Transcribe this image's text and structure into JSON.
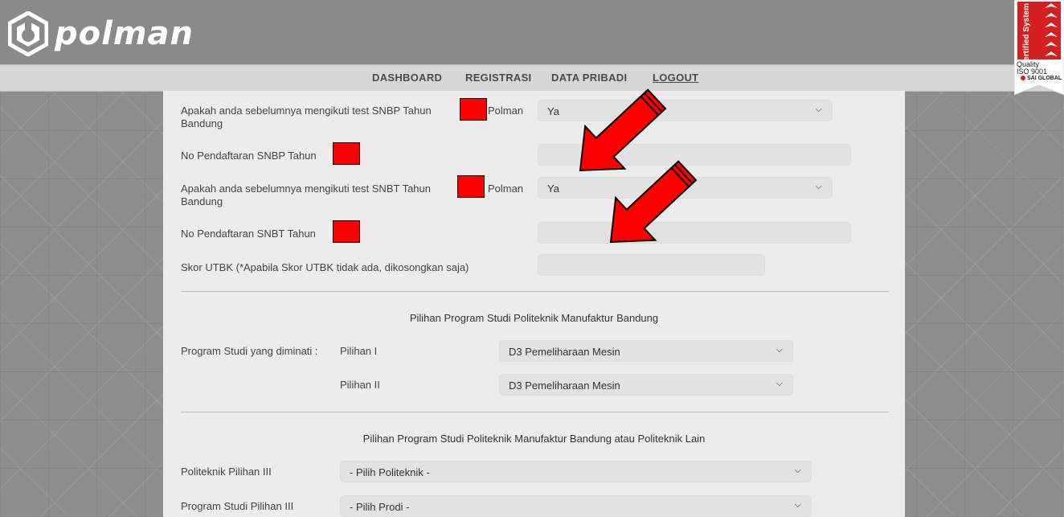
{
  "header": {
    "brand": "polman",
    "cert": {
      "line1": "Certified System",
      "line2": "Quality",
      "line3": "ISO 9001",
      "line4": "SAI GLOBAL"
    }
  },
  "nav": {
    "items": [
      "DASHBOARD",
      "REGISTRASI",
      "DATA PRIBADI",
      "LOGOUT"
    ]
  },
  "form": {
    "snbp_question_1": "Apakah anda sebelumnya mengikuti test SNBP Tahun",
    "snbp_question_2": "Polman",
    "snbp_question_3": "Bandung",
    "snbp_answer": "Ya",
    "snbp_no_label": "No Pendaftaran SNBP Tahun",
    "snbp_no_value": "",
    "snbt_question_1": "Apakah anda sebelumnya mengikuti test SNBT Tahun",
    "snbt_question_2": "Polman",
    "snbt_question_3": "Bandung",
    "snbt_answer": "Ya",
    "snbt_no_label": "No Pendaftaran SNBT Tahun",
    "snbt_no_value": "",
    "utbk_label": "Skor UTBK (*Apabila Skor UTBK tidak ada, dikosongkan saja)",
    "utbk_value": ""
  },
  "section1": {
    "title": "Pilihan Program Studi Politeknik Manufaktur Bandung",
    "prodi_label": "Program Studi yang diminati :",
    "choice1_label": "Pilihan I",
    "choice1_value": "D3 Pemeliharaan Mesin",
    "choice2_label": "Pilihan II",
    "choice2_value": "D3 Pemeliharaan Mesin"
  },
  "section2": {
    "title": "Pilihan Program Studi Politeknik Manufaktur Bandung atau Politeknik Lain",
    "politeknik_label": "Politeknik Pilihan III",
    "politeknik_value": "- Pilih Politeknik -",
    "prodi_label": "Program Studi Pilihan III",
    "prodi_value": "- Pilih Prodi -"
  },
  "icons": {
    "chevron": "chevron-down-icon",
    "arrow": "red-arrow-annotation-icon"
  },
  "colors": {
    "redaction": "#ff0000",
    "arrow": "#ff0000"
  }
}
